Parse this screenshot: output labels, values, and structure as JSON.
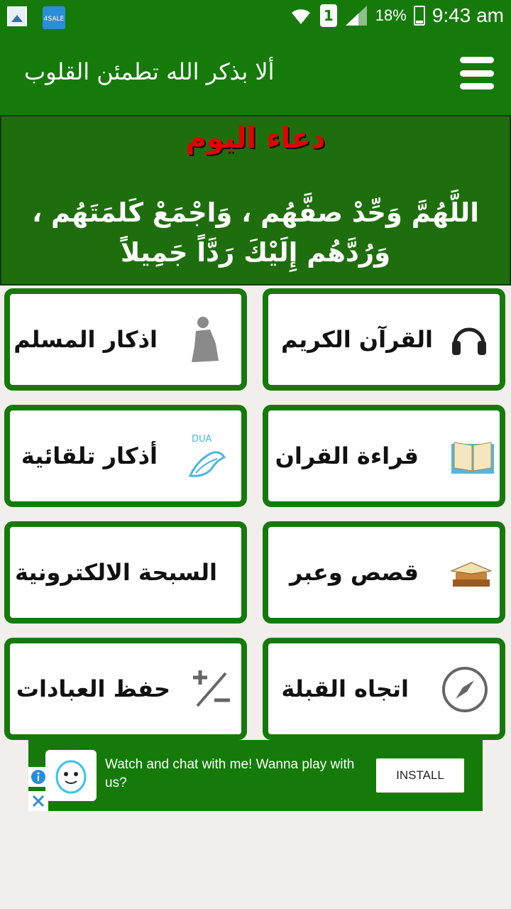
{
  "status_bar": {
    "sale_badge": "4SALE",
    "sim_slot": "1",
    "battery": "18%",
    "time": "9:43 am"
  },
  "app_bar": {
    "title": "ألا بذكر الله تطمئن القلوب"
  },
  "dua": {
    "title": "دعاء اليوم",
    "text": "اللَّهُمَّ وَحِّدْ صفَّهُم ، وَاجْمَعْ كَلمَتَهُم ، وَرُدَّهُم إِلَيْكَ رَدَّاً جَمِيلاً"
  },
  "menu_items": [
    {
      "label": "القرآن الكريم",
      "icon": "headphones-icon"
    },
    {
      "label": "اذكار المسلم",
      "icon": "praying-person-icon"
    },
    {
      "label": "قراءة القران",
      "icon": "open-book-icon"
    },
    {
      "label": "أذكار تلقائية",
      "icon": "dua-hands-icon"
    },
    {
      "label": "قصص وعبر",
      "icon": "books-stack-icon"
    },
    {
      "label": "السبحة الالكترونية",
      "icon": ""
    },
    {
      "label": "اتجاه القبلة",
      "icon": "compass-icon"
    },
    {
      "label": "حفظ العبادات",
      "icon": "plus-minus-icon"
    }
  ],
  "ad": {
    "text": "Watch and chat with me! Wanna play with us?",
    "install_label": "INSTALL"
  },
  "colors": {
    "primary_green": "#157a0a",
    "dua_title_red": "#e60000"
  }
}
